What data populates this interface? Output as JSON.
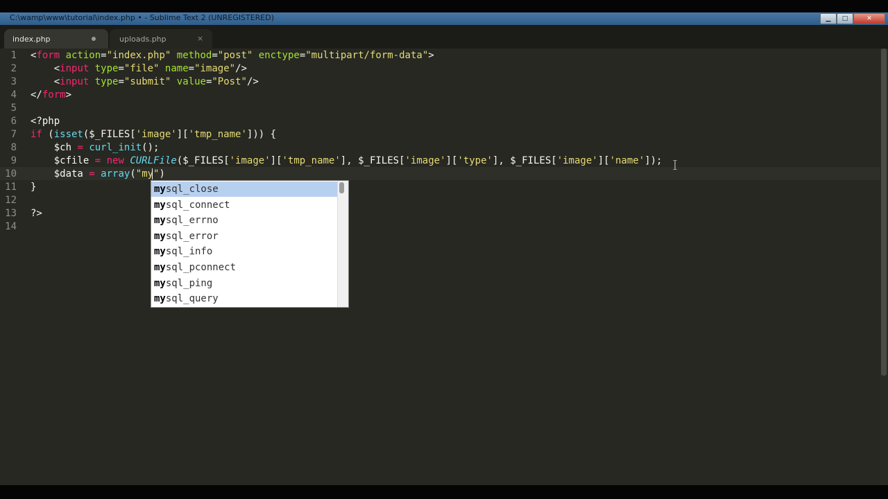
{
  "window": {
    "title": "C:\\wamp\\www\\tutorial\\index.php • - Sublime Text 2 (UNREGISTERED)",
    "buttons": {
      "minimize": "▁",
      "maximize": "□",
      "close": "✕"
    }
  },
  "tabs": [
    {
      "label": "index.php",
      "state": "active, unsaved"
    },
    {
      "label": "uploads.php",
      "close": "×"
    }
  ],
  "editor": {
    "current_line": 10,
    "line_numbers": [
      "1",
      "2",
      "3",
      "4",
      "5",
      "6",
      "7",
      "8",
      "9",
      "10",
      "11",
      "12",
      "13",
      "14"
    ],
    "lines": [
      [
        {
          "t": "<",
          "c": "pl"
        },
        {
          "t": "form",
          "c": "tag"
        },
        {
          "t": " ",
          "c": "pl"
        },
        {
          "t": "action",
          "c": "attr"
        },
        {
          "t": "=",
          "c": "pl"
        },
        {
          "t": "\"index.php\"",
          "c": "str"
        },
        {
          "t": " ",
          "c": "pl"
        },
        {
          "t": "method",
          "c": "attr"
        },
        {
          "t": "=",
          "c": "pl"
        },
        {
          "t": "\"post\"",
          "c": "str"
        },
        {
          "t": " ",
          "c": "pl"
        },
        {
          "t": "enctype",
          "c": "attr"
        },
        {
          "t": "=",
          "c": "pl"
        },
        {
          "t": "\"multipart/form-data\"",
          "c": "str"
        },
        {
          "t": ">",
          "c": "pl"
        }
      ],
      [
        {
          "t": "    <",
          "c": "pl"
        },
        {
          "t": "input",
          "c": "tag"
        },
        {
          "t": " ",
          "c": "pl"
        },
        {
          "t": "type",
          "c": "attr"
        },
        {
          "t": "=",
          "c": "pl"
        },
        {
          "t": "\"file\"",
          "c": "str"
        },
        {
          "t": " ",
          "c": "pl"
        },
        {
          "t": "name",
          "c": "attr"
        },
        {
          "t": "=",
          "c": "pl"
        },
        {
          "t": "\"image\"",
          "c": "str"
        },
        {
          "t": "/>",
          "c": "pl"
        }
      ],
      [
        {
          "t": "    <",
          "c": "pl"
        },
        {
          "t": "input",
          "c": "tag"
        },
        {
          "t": " ",
          "c": "pl"
        },
        {
          "t": "type",
          "c": "attr"
        },
        {
          "t": "=",
          "c": "pl"
        },
        {
          "t": "\"submit\"",
          "c": "str"
        },
        {
          "t": " ",
          "c": "pl"
        },
        {
          "t": "value",
          "c": "attr"
        },
        {
          "t": "=",
          "c": "pl"
        },
        {
          "t": "\"Post\"",
          "c": "str"
        },
        {
          "t": "/>",
          "c": "pl"
        }
      ],
      [
        {
          "t": "</",
          "c": "pl"
        },
        {
          "t": "form",
          "c": "tag"
        },
        {
          "t": ">",
          "c": "pl"
        }
      ],
      [],
      [
        {
          "t": "<?php",
          "c": "pl"
        }
      ],
      [
        {
          "t": "if",
          "c": "kw"
        },
        {
          "t": " (",
          "c": "pl"
        },
        {
          "t": "isset",
          "c": "fn"
        },
        {
          "t": "($_FILES[",
          "c": "pl"
        },
        {
          "t": "'image'",
          "c": "str"
        },
        {
          "t": "][",
          "c": "pl"
        },
        {
          "t": "'tmp_name'",
          "c": "str"
        },
        {
          "t": "])) {",
          "c": "pl"
        }
      ],
      [
        {
          "t": "    $ch ",
          "c": "pl"
        },
        {
          "t": "=",
          "c": "kw"
        },
        {
          "t": " ",
          "c": "pl"
        },
        {
          "t": "curl_init",
          "c": "fn"
        },
        {
          "t": "();",
          "c": "pl"
        }
      ],
      [
        {
          "t": "    $cfile ",
          "c": "pl"
        },
        {
          "t": "=",
          "c": "kw"
        },
        {
          "t": " ",
          "c": "pl"
        },
        {
          "t": "new",
          "c": "kw"
        },
        {
          "t": " ",
          "c": "pl"
        },
        {
          "t": "CURLFile",
          "c": "cls"
        },
        {
          "t": "($_FILES[",
          "c": "pl"
        },
        {
          "t": "'image'",
          "c": "str"
        },
        {
          "t": "][",
          "c": "pl"
        },
        {
          "t": "'tmp_name'",
          "c": "str"
        },
        {
          "t": "], $_FILES[",
          "c": "pl"
        },
        {
          "t": "'image'",
          "c": "str"
        },
        {
          "t": "][",
          "c": "pl"
        },
        {
          "t": "'type'",
          "c": "str"
        },
        {
          "t": "], $_FILES[",
          "c": "pl"
        },
        {
          "t": "'image'",
          "c": "str"
        },
        {
          "t": "][",
          "c": "pl"
        },
        {
          "t": "'name'",
          "c": "str"
        },
        {
          "t": "]);",
          "c": "pl"
        }
      ],
      [
        {
          "t": "    $data ",
          "c": "pl"
        },
        {
          "t": "=",
          "c": "kw"
        },
        {
          "t": " ",
          "c": "pl"
        },
        {
          "t": "array",
          "c": "fn"
        },
        {
          "t": "(",
          "c": "pl"
        },
        {
          "t": "\"my\"",
          "c": "str"
        },
        {
          "t": ")",
          "c": "pl"
        }
      ],
      [
        {
          "t": "}",
          "c": "pl"
        }
      ],
      [],
      [
        {
          "t": "?>",
          "c": "pl"
        }
      ],
      []
    ]
  },
  "autocomplete": {
    "prefix": "my",
    "items": [
      {
        "match": "my",
        "rest": "sql_close"
      },
      {
        "match": "my",
        "rest": "sql_connect"
      },
      {
        "match": "my",
        "rest": "sql_errno"
      },
      {
        "match": "my",
        "rest": "sql_error"
      },
      {
        "match": "my",
        "rest": "sql_info"
      },
      {
        "match": "my",
        "rest": "sql_pconnect"
      },
      {
        "match": "my",
        "rest": "sql_ping"
      },
      {
        "match": "my",
        "rest": "sql_query"
      }
    ],
    "selected_index": 0
  },
  "colors": {
    "background": "#272822",
    "tag": "#f92672",
    "attribute": "#a6e22e",
    "string": "#e6db74",
    "function": "#66d9ef",
    "selection": "#b8d0ef"
  }
}
